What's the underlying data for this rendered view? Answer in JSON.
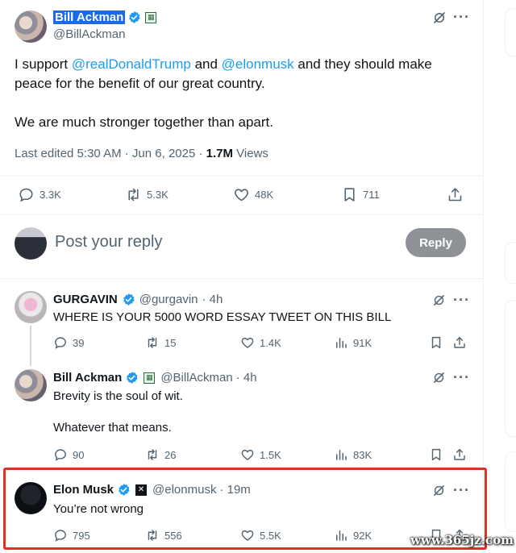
{
  "main_tweet": {
    "author_name": "Bill Ackman",
    "author_handle": "@BillAckman",
    "text_prefix": "I support ",
    "mention_1": "@realDonaldTrump",
    "text_mid": " and ",
    "mention_2": "@elonmusk",
    "text_suffix": " and they should make peace for the benefit of our great country.",
    "text_line2": "We are much stronger together than apart.",
    "meta_time": "Last edited 5:30 AM · Jun 6, 2025 · ",
    "meta_views_count": "1.7M",
    "meta_views_label": " Views",
    "replies": "3.3K",
    "reposts": "5.3K",
    "likes": "48K",
    "bookmarks": "711"
  },
  "compose": {
    "placeholder": "Post your reply",
    "button_label": "Reply"
  },
  "replies": [
    {
      "author_name": "GURGAVIN",
      "author_handle": "@gurgavin",
      "time": "· 4h",
      "text": "WHERE IS YOUR 5000 WORD ESSAY TWEET ON THIS BILL",
      "replies": "39",
      "reposts": "15",
      "likes": "1.4K",
      "views": "91K"
    },
    {
      "author_name": "Bill Ackman",
      "author_handle": "@BillAckman",
      "time": "· 4h",
      "text_line1": "Brevity is the soul of wit.",
      "text_line2": "Whatever that means.",
      "replies": "90",
      "reposts": "26",
      "likes": "1.5K",
      "views": "83K"
    },
    {
      "author_name": "Elon Musk",
      "author_handle": "@elonmusk",
      "time": "· 19m",
      "text": "You’re not wrong",
      "replies": "795",
      "reposts": "556",
      "likes": "5.5K",
      "views": "92K"
    }
  ],
  "colors": {
    "accent": "#1d9bf0",
    "highlight_border": "#e0302a",
    "muted": "#536471"
  },
  "icons": [
    "verified-icon",
    "grok-icon",
    "more-icon",
    "reply-icon",
    "repost-icon",
    "like-icon",
    "bookmark-icon",
    "share-icon",
    "views-icon"
  ],
  "watermark": "www.365jz.com"
}
